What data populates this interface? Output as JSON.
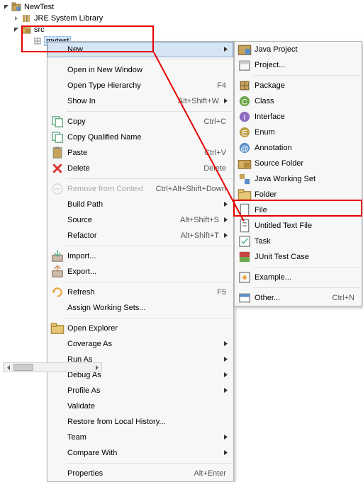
{
  "tree": {
    "root": "NewTest",
    "lib": "JRE System Library",
    "src": "src",
    "pkg": "mytest"
  },
  "menu": {
    "new": {
      "label": "New"
    },
    "openNewWindow": {
      "label": "Open in New Window"
    },
    "openTypeHierarchy": {
      "label": "Open Type Hierarchy",
      "shortcut": "F4"
    },
    "showIn": {
      "label": "Show In",
      "shortcut": "Alt+Shift+W"
    },
    "copy": {
      "label": "Copy",
      "shortcut": "Ctrl+C"
    },
    "copyQualified": {
      "label": "Copy Qualified Name"
    },
    "paste": {
      "label": "Paste",
      "shortcut": "Ctrl+V"
    },
    "delete": {
      "label": "Delete",
      "shortcut": "Delete"
    },
    "removeContext": {
      "label": "Remove from Context",
      "shortcut": "Ctrl+Alt+Shift+Down"
    },
    "buildPath": {
      "label": "Build Path"
    },
    "source": {
      "label": "Source",
      "shortcut": "Alt+Shift+S"
    },
    "refactor": {
      "label": "Refactor",
      "shortcut": "Alt+Shift+T"
    },
    "import": {
      "label": "Import..."
    },
    "export": {
      "label": "Export..."
    },
    "refresh": {
      "label": "Refresh",
      "shortcut": "F5"
    },
    "assignWorking": {
      "label": "Assign Working Sets..."
    },
    "openExplorer": {
      "label": "Open Explorer"
    },
    "coverageAs": {
      "label": "Coverage As"
    },
    "runAs": {
      "label": "Run As"
    },
    "debugAs": {
      "label": "Debug As"
    },
    "profileAs": {
      "label": "Profile As"
    },
    "validate": {
      "label": "Validate"
    },
    "restore": {
      "label": "Restore from Local History..."
    },
    "team": {
      "label": "Team"
    },
    "compareWith": {
      "label": "Compare With"
    },
    "properties": {
      "label": "Properties",
      "shortcut": "Alt+Enter"
    }
  },
  "submenu": {
    "javaProject": {
      "label": "Java Project"
    },
    "project": {
      "label": "Project..."
    },
    "package": {
      "label": "Package"
    },
    "class": {
      "label": "Class"
    },
    "interface": {
      "label": "Interface"
    },
    "enum": {
      "label": "Enum"
    },
    "annotation": {
      "label": "Annotation"
    },
    "sourceFolder": {
      "label": "Source Folder"
    },
    "javaWorkingSet": {
      "label": "Java Working Set"
    },
    "folder": {
      "label": "Folder"
    },
    "file": {
      "label": "File"
    },
    "untitledText": {
      "label": "Untitled Text File"
    },
    "task": {
      "label": "Task"
    },
    "junit": {
      "label": "JUnit Test Case"
    },
    "example": {
      "label": "Example..."
    },
    "other": {
      "label": "Other...",
      "shortcut": "Ctrl+N"
    }
  }
}
